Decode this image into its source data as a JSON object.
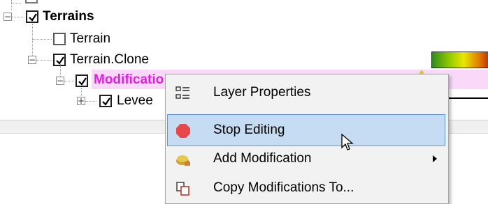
{
  "tree": {
    "terrains": {
      "label": "Terrains",
      "checked": true,
      "expanded": true
    },
    "terrain": {
      "label": "Terrain",
      "checked": false
    },
    "terrain_clone": {
      "label": "Terrain.Clone",
      "checked": true,
      "expanded": true
    },
    "modifications": {
      "label": "Modificatio",
      "checked": true,
      "expanded": true
    },
    "levee": {
      "label": "Levee",
      "checked": true,
      "expanded": false
    }
  },
  "context_menu": {
    "items": [
      {
        "label": "Layer Properties",
        "icon": "layer-properties-icon"
      },
      {
        "label": "Stop Editing",
        "icon": "stop-icon",
        "highlighted": true
      },
      {
        "label": "Add Modification",
        "icon": "add-modification-icon",
        "has_submenu": true
      },
      {
        "label": "Copy Modifications To...",
        "icon": "copy-icon"
      }
    ]
  },
  "colors": {
    "modification_label": "#e020e0",
    "row_highlight": "#f9d8f9",
    "menu_highlight": "#c5dcf2",
    "stop_icon": "#e8474c"
  }
}
